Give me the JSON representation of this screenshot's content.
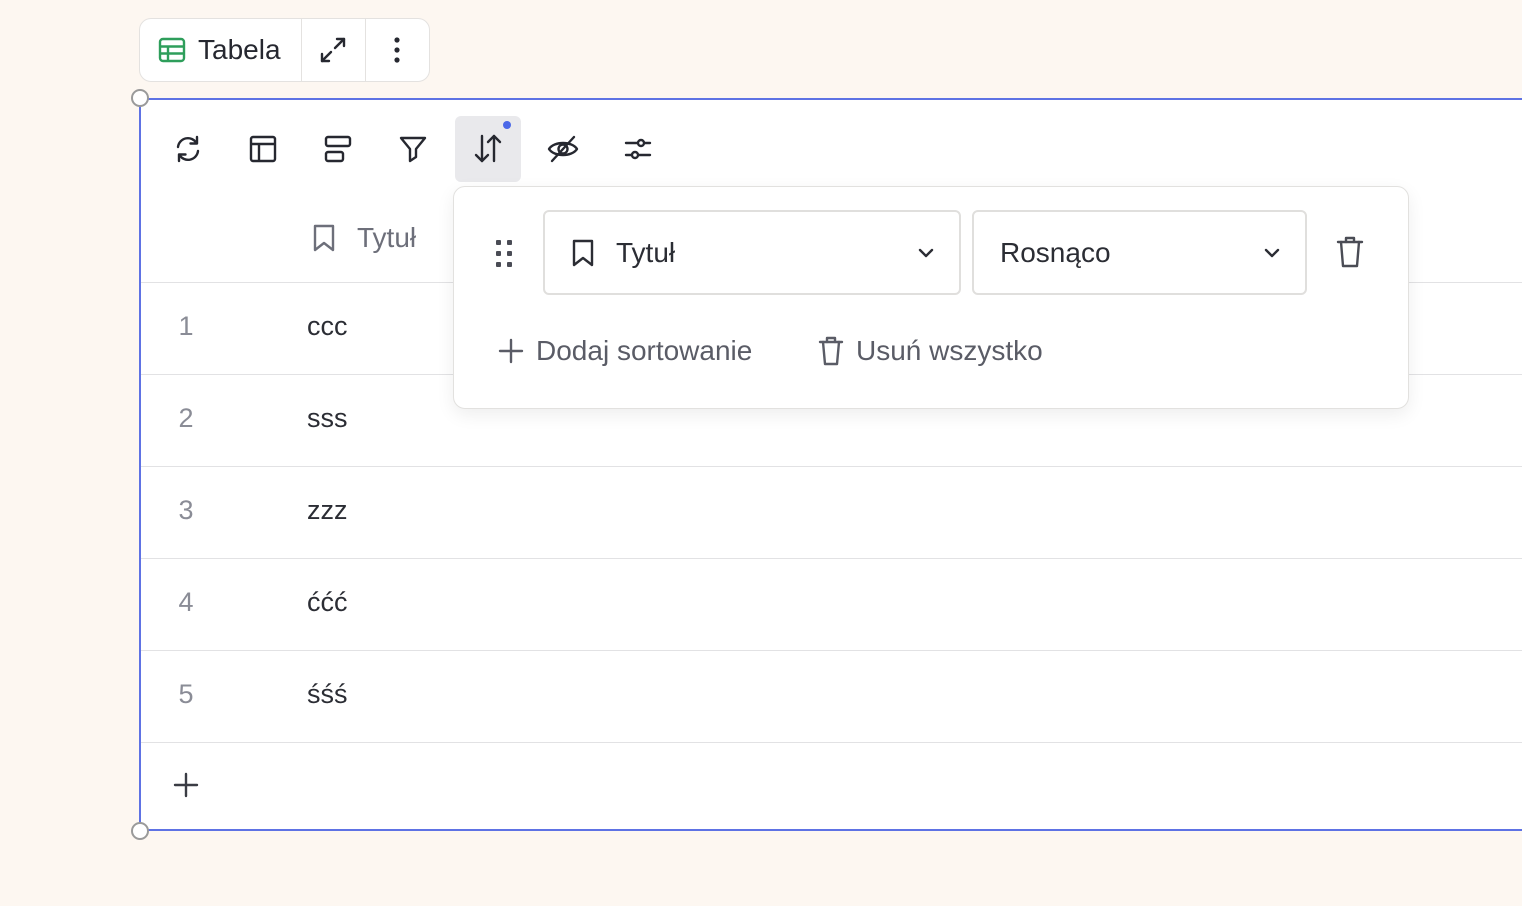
{
  "block_toolbar": {
    "type_label": "Tabela",
    "type_icon": "table-icon",
    "expand_icon": "expand-icon",
    "more_icon": "more-vertical-icon"
  },
  "view_toolbar": {
    "buttons": [
      {
        "icon": "refresh-icon"
      },
      {
        "icon": "layout-icon"
      },
      {
        "icon": "group-icon"
      },
      {
        "icon": "filter-icon"
      },
      {
        "icon": "sort-icon",
        "active": true
      },
      {
        "icon": "eye-off-icon"
      },
      {
        "icon": "settings-sliders-icon"
      }
    ]
  },
  "table": {
    "column_title": "Tytuł",
    "rows": [
      {
        "num": "1",
        "title": "ccc"
      },
      {
        "num": "2",
        "title": "sss"
      },
      {
        "num": "3",
        "title": "zzz"
      },
      {
        "num": "4",
        "title": "ććć"
      },
      {
        "num": "5",
        "title": "śśś"
      }
    ]
  },
  "sort_popover": {
    "field": "Tytuł",
    "direction": "Rosnąco",
    "add_label": "Dodaj sortowanie",
    "remove_all_label": "Usuń wszystko"
  },
  "colors": {
    "accent": "#5e72e4",
    "table_icon": "#2e9e5b",
    "background": "#fdf7f1"
  }
}
